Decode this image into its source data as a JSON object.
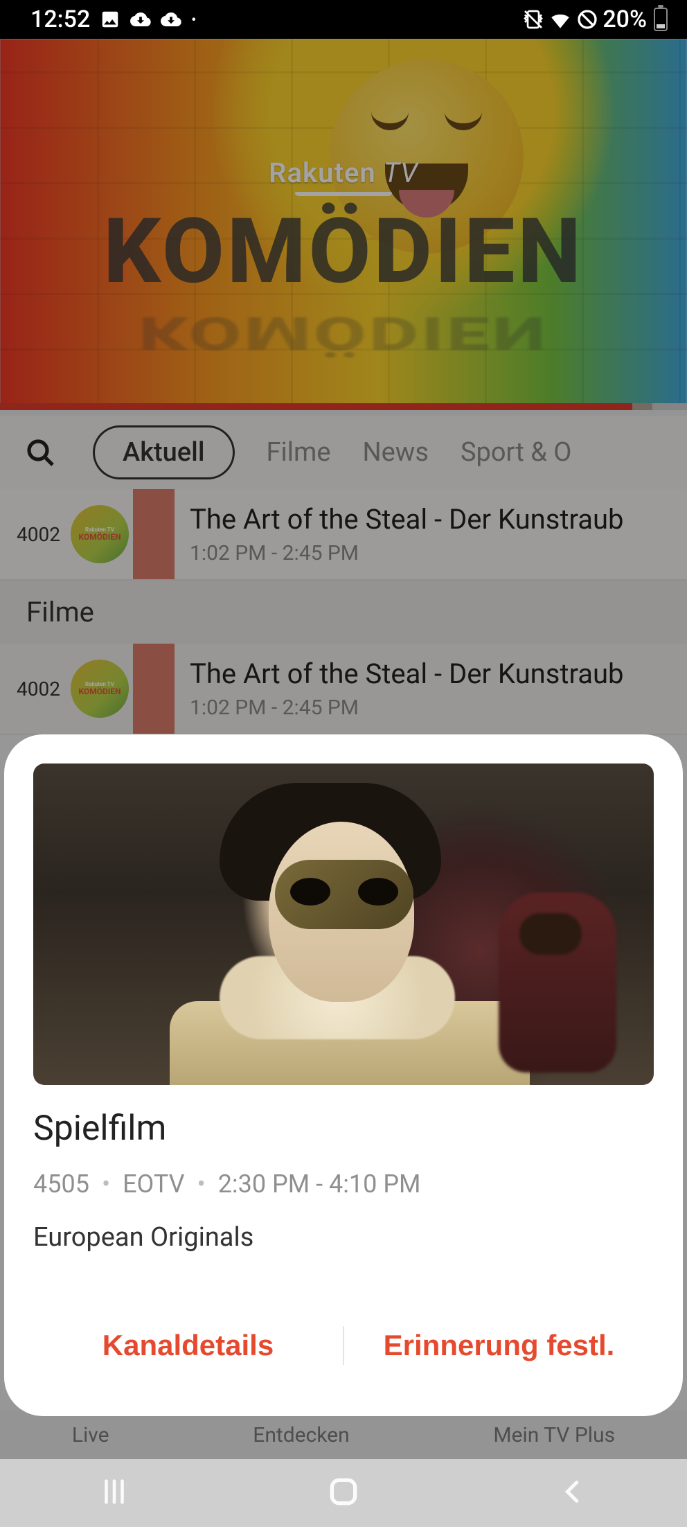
{
  "status": {
    "time": "12:52",
    "battery_pct": "20%"
  },
  "hero": {
    "brand": "Rakuten",
    "brand_suffix": "TV",
    "title": "KOMÖDIEN",
    "progress_pct": 92
  },
  "tabs": {
    "active": "Aktuell",
    "items": [
      "Aktuell",
      "Filme",
      "News",
      "Sport & O"
    ]
  },
  "list": {
    "rows": [
      {
        "channel_number": "4002",
        "channel_logo_text": "KOMÖDIEN",
        "title": "The Art of the Steal - Der Kunstraub",
        "time": "1:02 PM - 2:45 PM"
      }
    ],
    "section_header": "Filme",
    "rows2": [
      {
        "channel_number": "4002",
        "channel_logo_text": "KOMÖDIEN",
        "title": "The Art of the Steal - Der Kunstraub",
        "time": "1:02 PM - 2:45 PM"
      }
    ]
  },
  "bottom_nav": {
    "items": [
      "Live",
      "Entdecken",
      "Mein TV Plus"
    ]
  },
  "sheet": {
    "title": "Spielfilm",
    "channel_number": "4505",
    "channel_name": "EOTV",
    "time": "2:30 PM - 4:10 PM",
    "description": "European Originals",
    "action_details": "Kanaldetails",
    "action_reminder": "Erinnerung festl."
  }
}
